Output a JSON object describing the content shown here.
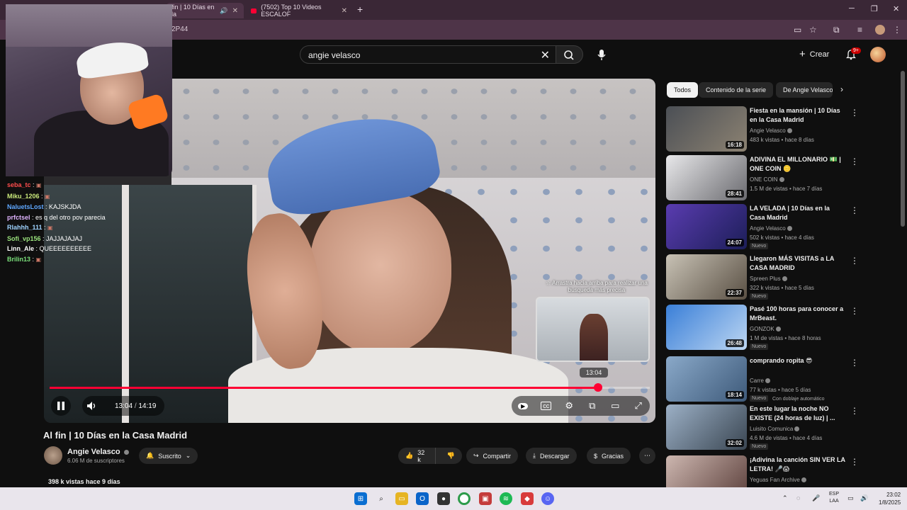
{
  "browser": {
    "tab1_title": "fin | 10 Días en la",
    "tab2_title": "(7502) Top 10 Videos ESCALOF",
    "new_tab": "+",
    "url_fragment": "2P44"
  },
  "header": {
    "search_value": "angie velasco",
    "create_label": "Crear",
    "notifications_count": "9+"
  },
  "chat": [
    {
      "user": "seba_tc",
      "msg": "",
      "color": "#ff4d4d"
    },
    {
      "user": "Miku_1206",
      "msg": "",
      "color": "#c9e87a"
    },
    {
      "user": "NaluetsLost",
      "msg": "KAJSKJDA",
      "color": "#5fa8ff"
    },
    {
      "user": "prfctsel",
      "msg": "es q del otro pov parecia",
      "color": "#e0b4ff"
    },
    {
      "user": "Rlahhh_111",
      "msg": "",
      "color": "#9fd3ff"
    },
    {
      "user": "Sofi_vp156",
      "msg": "JAJJAJAJAJ",
      "color": "#9be37d"
    },
    {
      "user": "Linn_Ale",
      "msg": "QUEEEEEEEEEE",
      "color": "#ffffff"
    },
    {
      "user": "Brilin13",
      "msg": "",
      "color": "#7be07b"
    }
  ],
  "player": {
    "preview_hint": "☆ Arrastra hacia arriba para realizar una búsqueda más precisa",
    "preview_time": "13:04",
    "current_time": "13:04",
    "duration": "14:19",
    "progress_fraction": 0.914
  },
  "video": {
    "title": "Al fin | 10 Días en la Casa Madrid",
    "channel": "Angie Velasco",
    "subscribers": "6.06 M de suscriptores",
    "subscribed_label": "Suscrito",
    "likes": "32 k",
    "share_label": "Compartir",
    "download_label": "Descargar",
    "thanks_label": "Gracias",
    "views": "398 k vistas  hace 9 días"
  },
  "chips": [
    "Todos",
    "Contenido de la serie",
    "De Angie Velasco"
  ],
  "recommendations": [
    {
      "title": "Fiesta en la mansión | 10 Días en la Casa Madrid",
      "channel": "Angie Velasco",
      "meta": "483 k vistas • hace 8 días",
      "badge": "",
      "duration": "16:18",
      "colors": [
        "#4b4f55",
        "#8c8272"
      ]
    },
    {
      "title": "ADIVINA EL MILLONARIO 💵 | ONE COIN 🪙",
      "channel": "ONE COIN",
      "meta": "1.5 M de vistas • hace 7 días",
      "badge": "",
      "duration": "28:41",
      "colors": [
        "#e8e8ea",
        "#6b6b70"
      ]
    },
    {
      "title": "LA VELADA | 10 Días en la Casa Madrid",
      "channel": "Angie Velasco",
      "meta": "502 k vistas • hace 4 días",
      "badge": "Nuevo",
      "duration": "24:07",
      "colors": [
        "#5a3cb0",
        "#1c1e58"
      ]
    },
    {
      "title": "Llegaron MÁS VISITAS a LA CASA MADRID",
      "channel": "Spreen Plus",
      "meta": "322 k vistas • hace 5 días",
      "badge": "Nuevo",
      "duration": "22:37",
      "colors": [
        "#c8c2b5",
        "#5a5044"
      ]
    },
    {
      "title": "Pasé 100 horas para conocer a MrBeast.",
      "channel": "GONZOK",
      "meta": "1 M de vistas • hace 8 horas",
      "badge": "Nuevo",
      "duration": "26:48",
      "colors": [
        "#3a7fd8",
        "#bcd6f2"
      ]
    },
    {
      "title": "comprando ropita 😎",
      "channel": "Carre",
      "meta": "77 k vistas • hace 5 días",
      "badge": "Nuevo",
      "extra": "Con doblaje automático",
      "duration": "18:14",
      "colors": [
        "#8aa9c9",
        "#3e5a7a"
      ]
    },
    {
      "title": "En este lugar la noche NO EXISTE (24 horas de luz) | ...",
      "channel": "Luisito Comunica",
      "meta": "4.6 M de vistas • hace 4 días",
      "badge": "Nuevo",
      "duration": "32:02",
      "colors": [
        "#9cb0c6",
        "#3a4652"
      ]
    },
    {
      "title": "¡Adivina la canción SIN VER LA LETRA! 🎤😱",
      "channel": "Yeguas Fan Archive",
      "meta": "",
      "badge": "",
      "duration": "",
      "colors": [
        "#cdb7b0",
        "#5a3e3a"
      ]
    }
  ],
  "taskbar": {
    "lang": "ESP",
    "region": "LAA",
    "time": "23:02",
    "date": "1/8/2025"
  },
  "colors": {
    "accent": "#ff0033",
    "background": "#0f0f0f",
    "chrome": "#3a2736"
  }
}
